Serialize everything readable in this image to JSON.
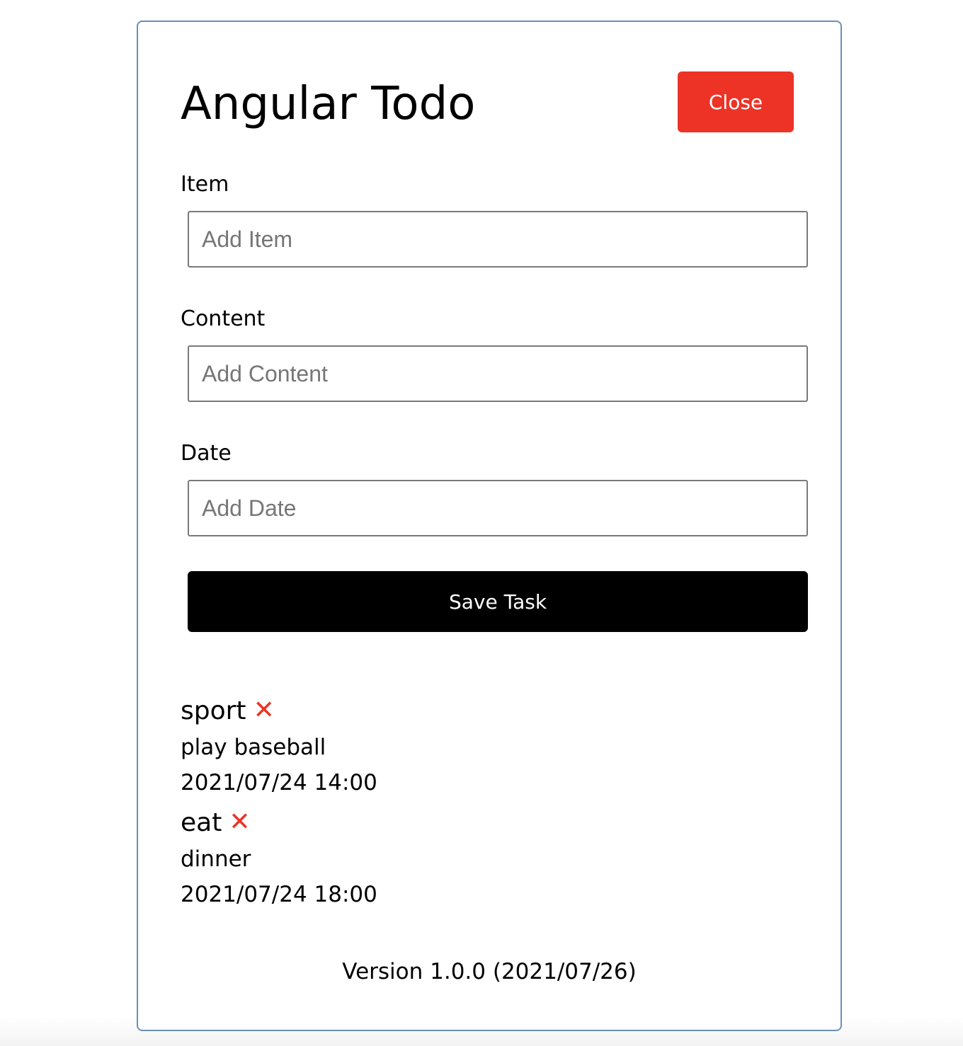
{
  "app": {
    "title": "Angular Todo",
    "close_label": "Close"
  },
  "form": {
    "item": {
      "label": "Item",
      "placeholder": "Add Item",
      "value": ""
    },
    "content": {
      "label": "Content",
      "placeholder": "Add Content",
      "value": ""
    },
    "date": {
      "label": "Date",
      "placeholder": "Add Date",
      "value": ""
    },
    "save_label": "Save Task"
  },
  "tasks": [
    {
      "title": "sport",
      "content": "play baseball",
      "date": "2021/07/24 14:00",
      "delete_icon": "close-x-icon"
    },
    {
      "title": "eat",
      "content": "dinner",
      "date": "2021/07/24 18:00",
      "delete_icon": "close-x-icon"
    }
  ],
  "footer": {
    "version": "Version 1.0.0 (2021/07/26)"
  },
  "colors": {
    "close_button": "#ec3326",
    "save_button": "#000000",
    "delete_icon": "#ec3326",
    "card_border": "#6a8fb8"
  }
}
